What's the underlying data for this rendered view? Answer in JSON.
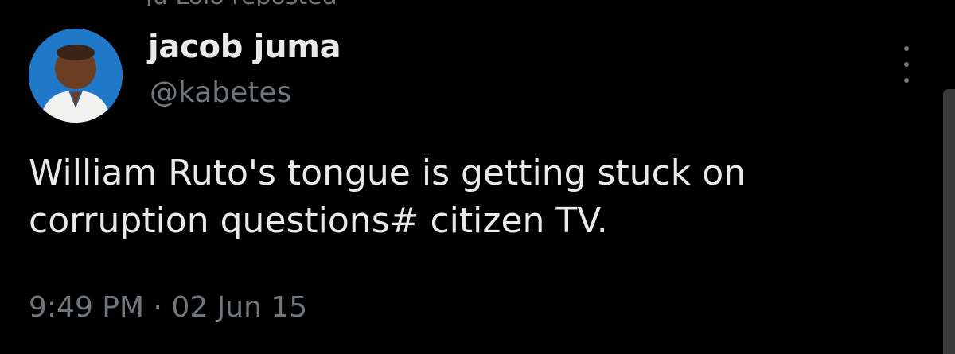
{
  "header": {
    "repost_text": "Ju Lolo reposted"
  },
  "author": {
    "display_name": "jacob juma",
    "handle": "@kabetes",
    "avatar_icon": "profile-photo"
  },
  "tweet": {
    "text": "William Ruto's tongue is getting stuck on\ncorruption questions# citizen TV.",
    "time": "9:49 PM",
    "separator": "·",
    "date": "02 Jun 15"
  },
  "actions": {
    "more_icon": "more-vertical-icon"
  },
  "colors": {
    "background": "#000000",
    "primary_text": "#e7e9ea",
    "secondary_text": "#71767b"
  }
}
